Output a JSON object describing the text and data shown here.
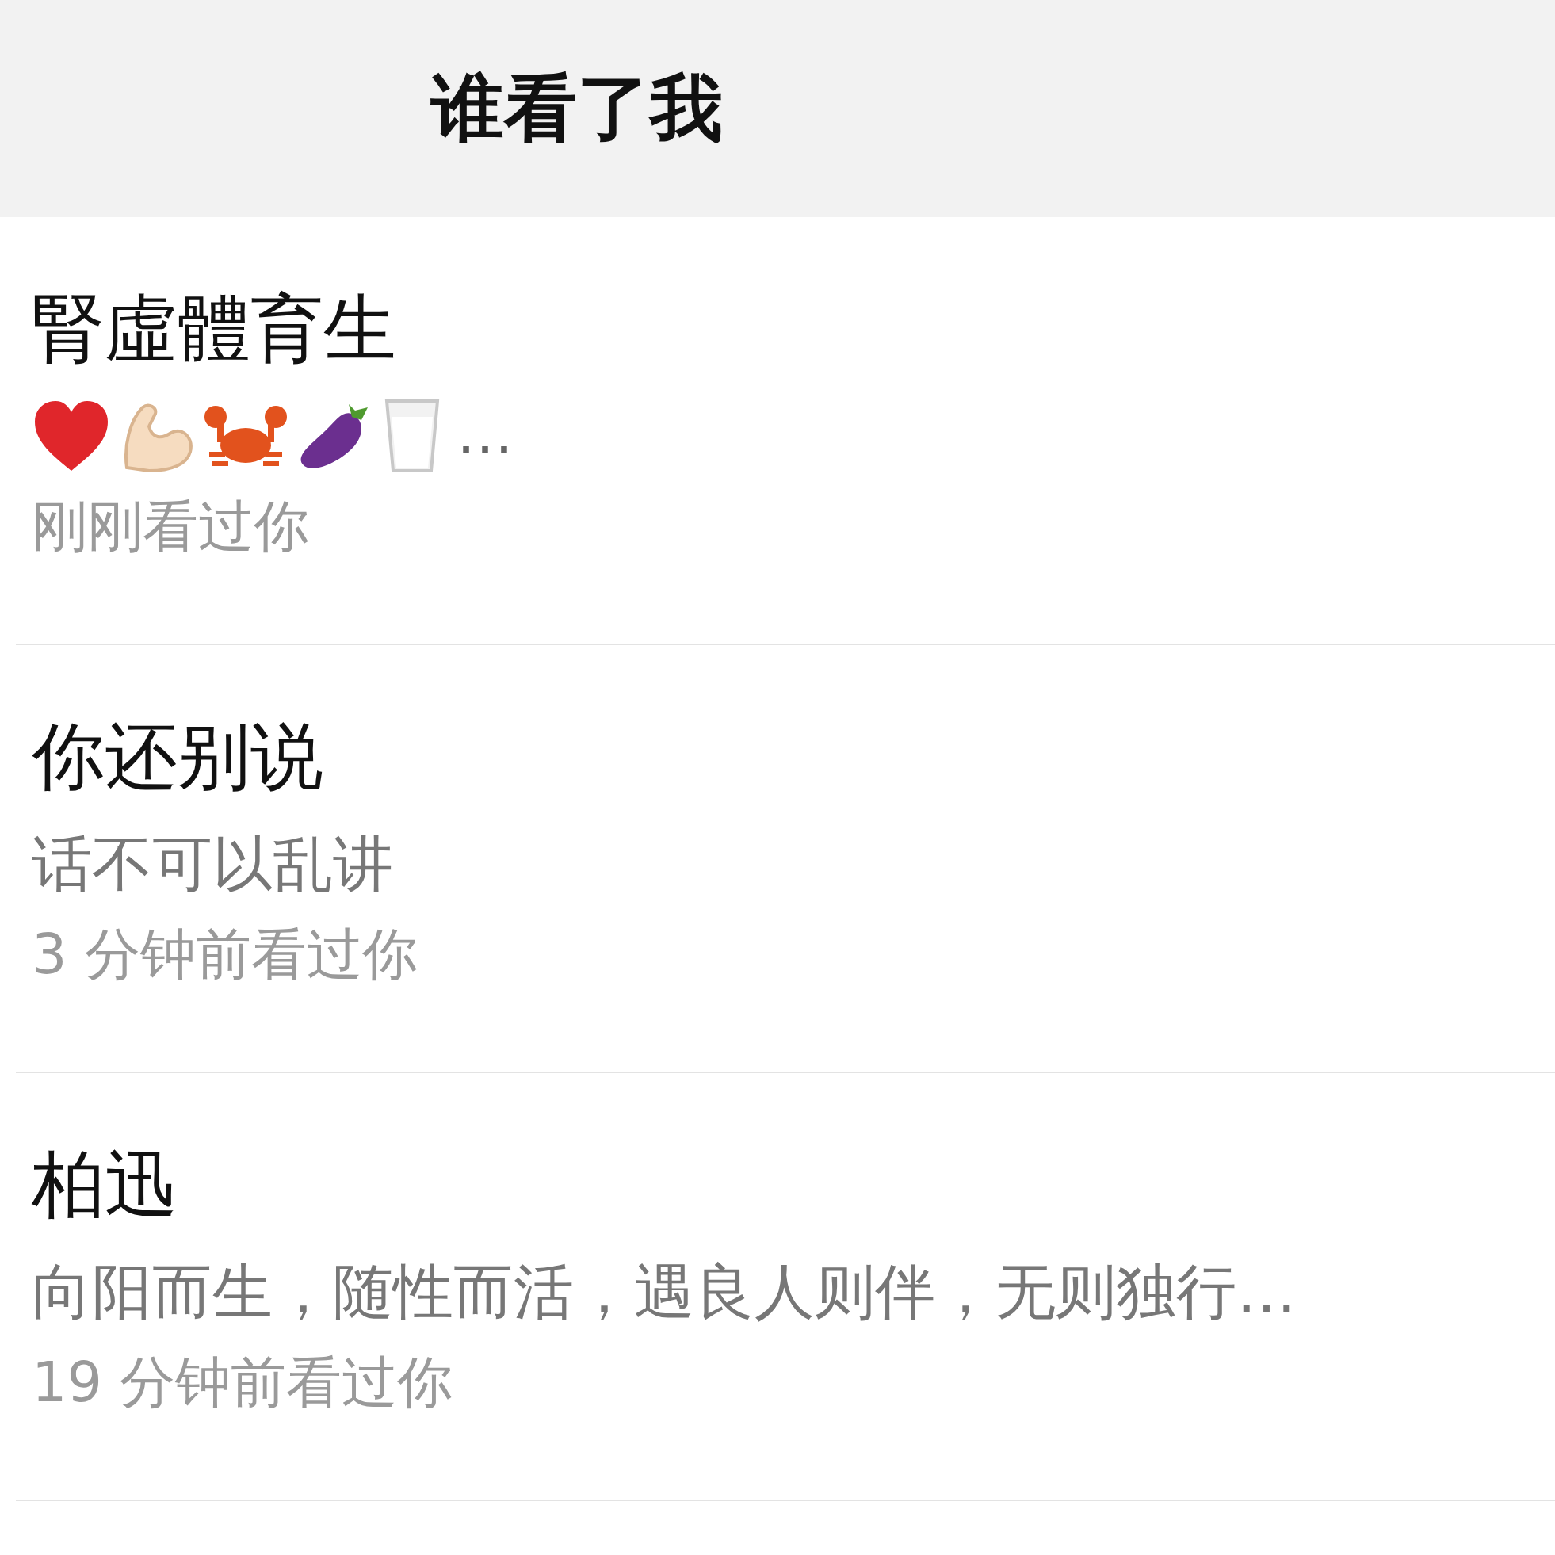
{
  "header": {
    "title": "谁看了我"
  },
  "visitors": [
    {
      "name": "腎虛體育生",
      "kind": "emoji",
      "signature": "…",
      "time": "刚刚看过你"
    },
    {
      "name": "你还别说",
      "kind": "text",
      "signature": "话不可以乱讲",
      "time": "3 分钟前看过你"
    },
    {
      "name": "柏迅",
      "kind": "text",
      "signature": "向阳而生，随性而活，遇良人则伴，无则独行…",
      "time": "19 分钟前看过你"
    }
  ]
}
